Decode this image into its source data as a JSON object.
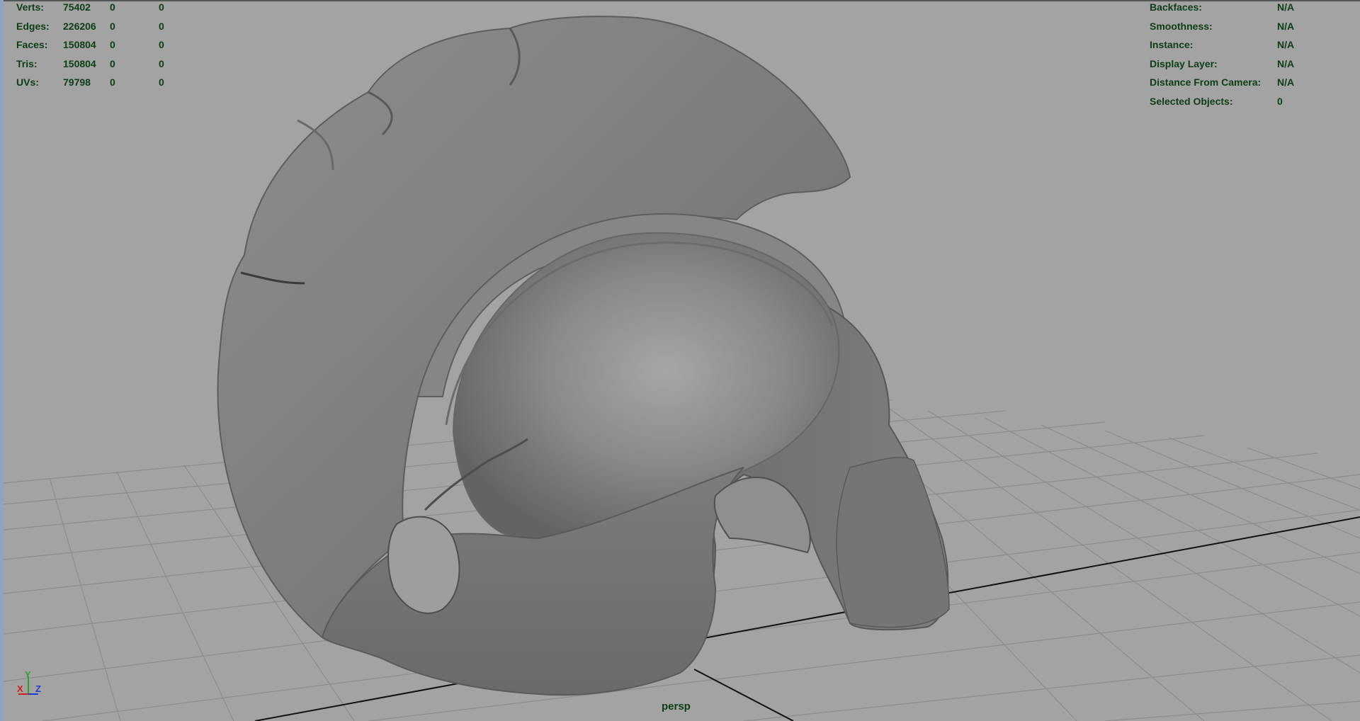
{
  "viewport": {
    "camera": "persp",
    "object": "helmet-mesh"
  },
  "hud_left": {
    "rows": [
      {
        "label": "Verts:",
        "value": "75402",
        "selected": "0",
        "component": "0"
      },
      {
        "label": "Edges:",
        "value": "226206",
        "selected": "0",
        "component": "0"
      },
      {
        "label": "Faces:",
        "value": "150804",
        "selected": "0",
        "component": "0"
      },
      {
        "label": "Tris:",
        "value": "150804",
        "selected": "0",
        "component": "0"
      },
      {
        "label": "UVs:",
        "value": "79798",
        "selected": "0",
        "component": "0"
      }
    ]
  },
  "hud_right": {
    "rows": [
      {
        "label": "Backfaces:",
        "value": "N/A"
      },
      {
        "label": "Smoothness:",
        "value": "N/A"
      },
      {
        "label": "Instance:",
        "value": "N/A"
      },
      {
        "label": "Display Layer:",
        "value": "N/A"
      },
      {
        "label": "Distance From Camera:",
        "value": "N/A"
      },
      {
        "label": "Selected Objects:",
        "value": "0"
      }
    ]
  },
  "axis_gizmo": {
    "x": "X",
    "y": "Y",
    "z": "Z"
  },
  "colors": {
    "background": "#a3a3a3",
    "grid_line": "#8c8c8c",
    "grid_axis": "#111111",
    "hud_text": "#0d3d16",
    "mesh": "#7d7d7d"
  }
}
